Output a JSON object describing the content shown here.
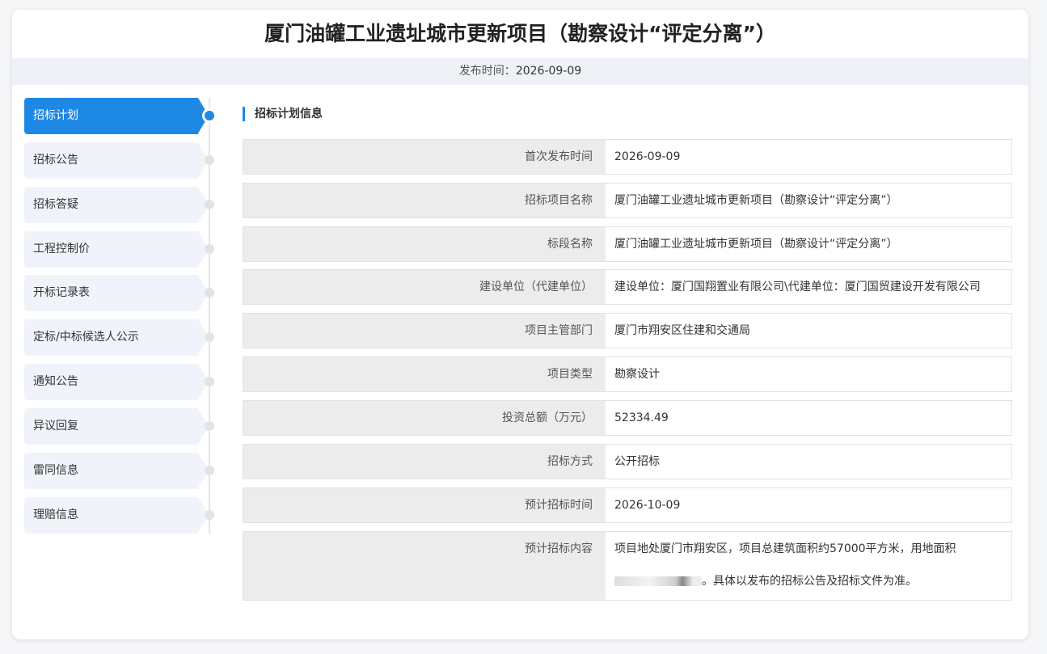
{
  "page": {
    "title": "厦门油罐工业遗址城市更新项目（勘察设计“评定分离”）",
    "publish_label": "发布时间：",
    "publish_date": "2026-09-09"
  },
  "sidebar": {
    "items": [
      {
        "label": "招标计划",
        "active": true
      },
      {
        "label": "招标公告",
        "active": false
      },
      {
        "label": "招标答疑",
        "active": false
      },
      {
        "label": "工程控制价",
        "active": false
      },
      {
        "label": "开标记录表",
        "active": false
      },
      {
        "label": "定标/中标候选人公示",
        "active": false
      },
      {
        "label": "通知公告",
        "active": false
      },
      {
        "label": "异议回复",
        "active": false
      },
      {
        "label": "雷同信息",
        "active": false
      },
      {
        "label": "理赔信息",
        "active": false
      }
    ]
  },
  "section": {
    "title": "招标计划信息",
    "rows": [
      {
        "key": "首次发布时间",
        "value": "2026-09-09"
      },
      {
        "key": "招标项目名称",
        "value": "厦门油罐工业遗址城市更新项目（勘察设计“评定分离”）"
      },
      {
        "key": "标段名称",
        "value": "厦门油罐工业遗址城市更新项目（勘察设计“评定分离”）"
      },
      {
        "key": "建设单位（代建单位）",
        "value": "建设单位：厦门国翔置业有限公司\\代建单位：厦门国贸建设开发有限公司"
      },
      {
        "key": "项目主管部门",
        "value": "厦门市翔安区住建和交通局"
      },
      {
        "key": "项目类型",
        "value": "勘察设计"
      },
      {
        "key": "投资总额（万元）",
        "value": "52334.49"
      },
      {
        "key": "招标方式",
        "value": "公开招标"
      },
      {
        "key": "预计招标时间",
        "value": "2026-10-09"
      }
    ],
    "content_row": {
      "key": "预计招标内容",
      "line1": "项目地处厦门市翔安区，项目总建筑面积约57000平方米，用地面积",
      "line2": "。具体以发布的招标公告及招标文件为准。"
    }
  }
}
